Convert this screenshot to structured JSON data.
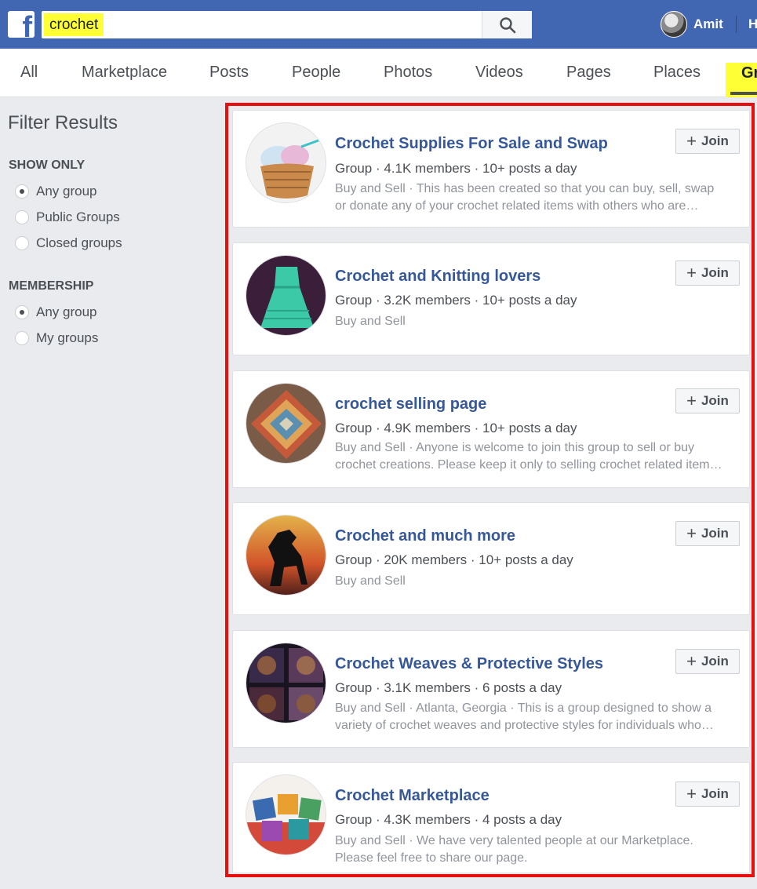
{
  "header": {
    "logo_letter": "f",
    "search_value": "crochet",
    "profile_name": "Amit",
    "home_link": "H"
  },
  "tabs": [
    {
      "label": "All"
    },
    {
      "label": "Marketplace"
    },
    {
      "label": "Posts"
    },
    {
      "label": "People"
    },
    {
      "label": "Photos"
    },
    {
      "label": "Videos"
    },
    {
      "label": "Pages"
    },
    {
      "label": "Places"
    }
  ],
  "active_tab": "Gr",
  "sidebar": {
    "title": "Filter Results",
    "show_only": {
      "heading": "SHOW ONLY",
      "options": [
        {
          "label": "Any group",
          "checked": true
        },
        {
          "label": "Public Groups",
          "checked": false
        },
        {
          "label": "Closed groups",
          "checked": false
        }
      ]
    },
    "membership": {
      "heading": "MEMBERSHIP",
      "options": [
        {
          "label": "Any group",
          "checked": true
        },
        {
          "label": "My groups",
          "checked": false
        }
      ]
    }
  },
  "join_label": "Join",
  "results": [
    {
      "title": "Crochet Supplies For Sale and Swap",
      "meta": "Group · 4.1K members · 10+ posts a day",
      "desc_line1": "Buy and Sell · This has been created so that you can buy, sell, swap",
      "desc_line2": "or donate any of your crochet related items with others who are…",
      "image": "yarn-basket"
    },
    {
      "title": "Crochet and Knitting lovers",
      "meta": "Group · 3.2K members · 10+ posts a day",
      "desc_line1": "Buy and Sell",
      "desc_line2": "",
      "image": "green-dress"
    },
    {
      "title": "crochet selling page",
      "meta": "Group · 4.9K members · 10+ posts a day",
      "desc_line1": "Buy and Sell · Anyone is welcome to join this group to sell or buy",
      "desc_line2": "crochet creations. Please keep it only to selling crochet related item…",
      "image": "granny-blanket"
    },
    {
      "title": "Crochet and much more",
      "meta": "Group · 20K members · 10+ posts a day",
      "desc_line1": "Buy and Sell",
      "desc_line2": "",
      "image": "horse-tapestry"
    },
    {
      "title": "Crochet Weaves & Protective Styles",
      "meta": "Group · 3.1K members · 6 posts a day",
      "desc_line1": "Buy and Sell · Atlanta, Georgia · This is a group designed to show a",
      "desc_line2": "variety of crochet weaves and protective styles for individuals who…",
      "image": "weaves-collage"
    },
    {
      "title": "Crochet Marketplace",
      "meta": "Group · 4.3K members · 4 posts a day",
      "desc_line1": "Buy and Sell · We have very talented people at our Marketplace.",
      "desc_line2": "Please feel free to share our page.",
      "image": "pillows"
    }
  ]
}
